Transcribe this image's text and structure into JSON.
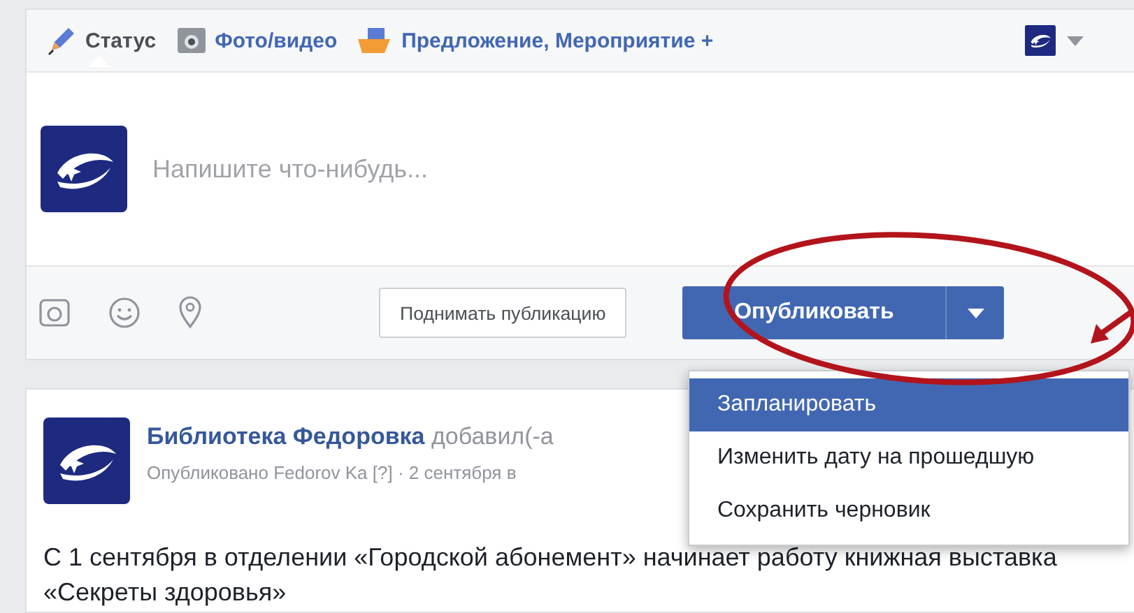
{
  "composer": {
    "tabs": [
      {
        "label": "Статус",
        "kind": "pencil",
        "selected": true
      },
      {
        "label": "Фото/видео",
        "kind": "camera",
        "selected": false
      },
      {
        "label": "Предложение, Мероприятие +",
        "kind": "offer",
        "selected": false
      }
    ],
    "placeholder": "Напишите что-нибудь...",
    "boost_button": "Поднимать публикацию",
    "publish_button": "Опубликовать",
    "menu": [
      {
        "label": "Запланировать",
        "selected": true
      },
      {
        "label": "Изменить дату на прошедшую",
        "selected": false
      },
      {
        "label": "Сохранить черновик",
        "selected": false
      }
    ]
  },
  "post": {
    "author": "Библиотека Федоровка",
    "action": "добавил(-а",
    "meta": "Опубликовано Fedorov Ka [?] · 2 сентября в",
    "text": "С 1 сентября в отделении «Городской абонемент» начинает работу книжная выставка «Секреты здоровья»"
  }
}
